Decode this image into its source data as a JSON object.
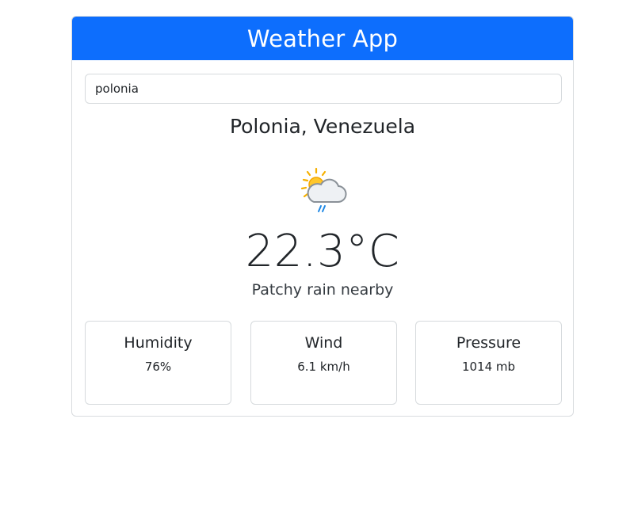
{
  "header": {
    "title": "Weather App"
  },
  "search": {
    "value": "polonia"
  },
  "location": "Polonia, Venezuela",
  "icon": "sun-cloud-rain-icon",
  "temperature": "22.3°C",
  "condition": "Patchy rain nearby",
  "stats": [
    {
      "label": "Humidity",
      "value": "76%"
    },
    {
      "label": "Wind",
      "value": "6.1 km/h"
    },
    {
      "label": "Pressure",
      "value": "1014 mb"
    }
  ],
  "colors": {
    "header_bg": "#0d6efd",
    "header_text": "#ffffff",
    "border": "#d6dadd"
  }
}
